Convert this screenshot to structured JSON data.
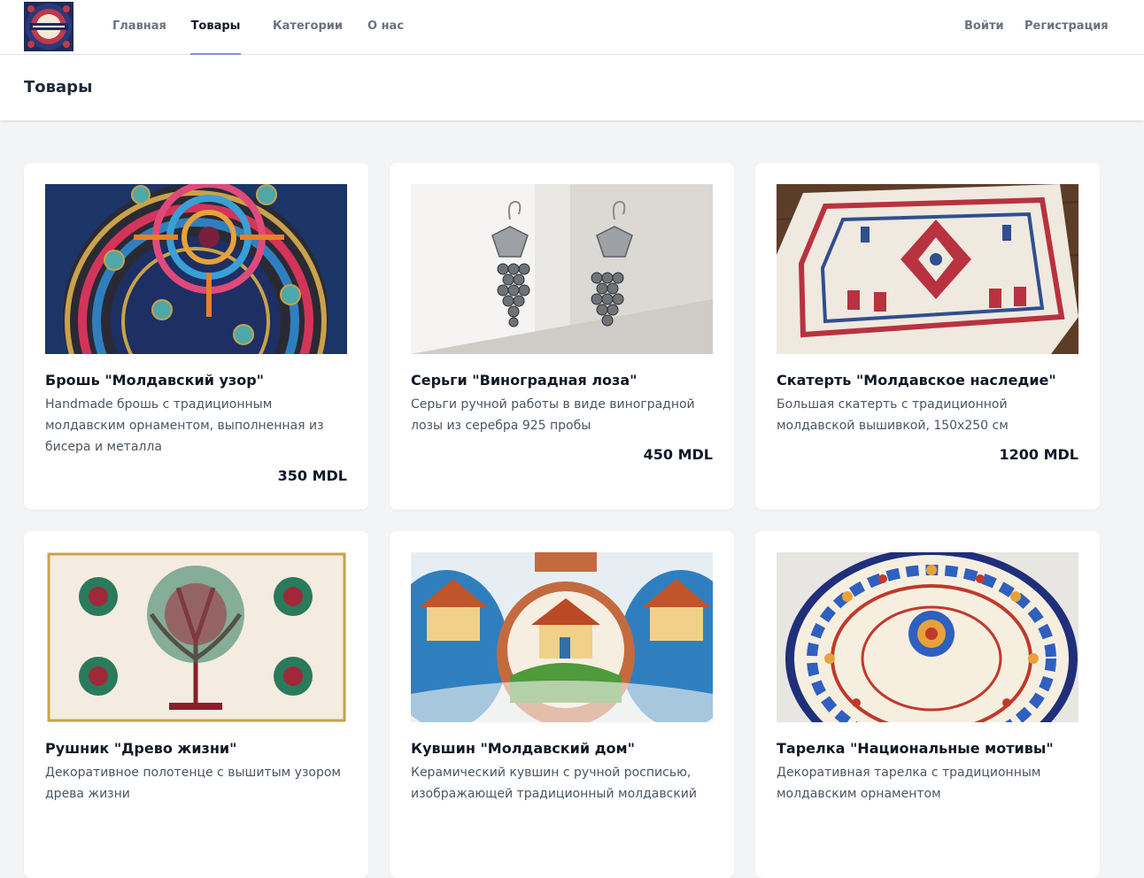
{
  "nav": {
    "logo_alt": "HANDMADE MD",
    "links": [
      {
        "label": "Главная"
      },
      {
        "label": "Товары"
      },
      {
        "label": "Категории"
      },
      {
        "label": "О нас"
      }
    ],
    "login": "Войти",
    "register": "Регистрация"
  },
  "header": {
    "title": "Товары"
  },
  "products": [
    {
      "title": "Брошь \"Молдавский узор\"",
      "description": "Handmade брошь с традиционным молдавским орнаментом, выполненная из бисера и металла",
      "price": "350 MDL",
      "image": "beaded-brooch"
    },
    {
      "title": "Серьги \"Виноградная лоза\"",
      "description": "Серьги ручной работы в виде виноградной лозы из серебра 925 пробы",
      "price": "450 MDL",
      "image": "grape-earrings"
    },
    {
      "title": "Скатерть \"Молдавское наследие\"",
      "description": "Большая скатерть с традиционной молдавской вышивкой, 150x250 см",
      "price": "1200 MDL",
      "image": "embroidered-tablecloth"
    },
    {
      "title": "Рушник \"Древо жизни\"",
      "description": "Декоративное полотенце с вышитым узором древа жизни",
      "price": "",
      "image": "tree-of-life-towel"
    },
    {
      "title": "Кувшин \"Молдавский дом\"",
      "description": "Керамический кувшин с ручной росписью, изображающей традиционный молдавский",
      "price": "",
      "image": "painted-jug"
    },
    {
      "title": "Тарелка \"Национальные мотивы\"",
      "description": "Декоративная тарелка с традиционным молдавским орнаментом",
      "price": "",
      "image": "decorative-plate"
    }
  ]
}
